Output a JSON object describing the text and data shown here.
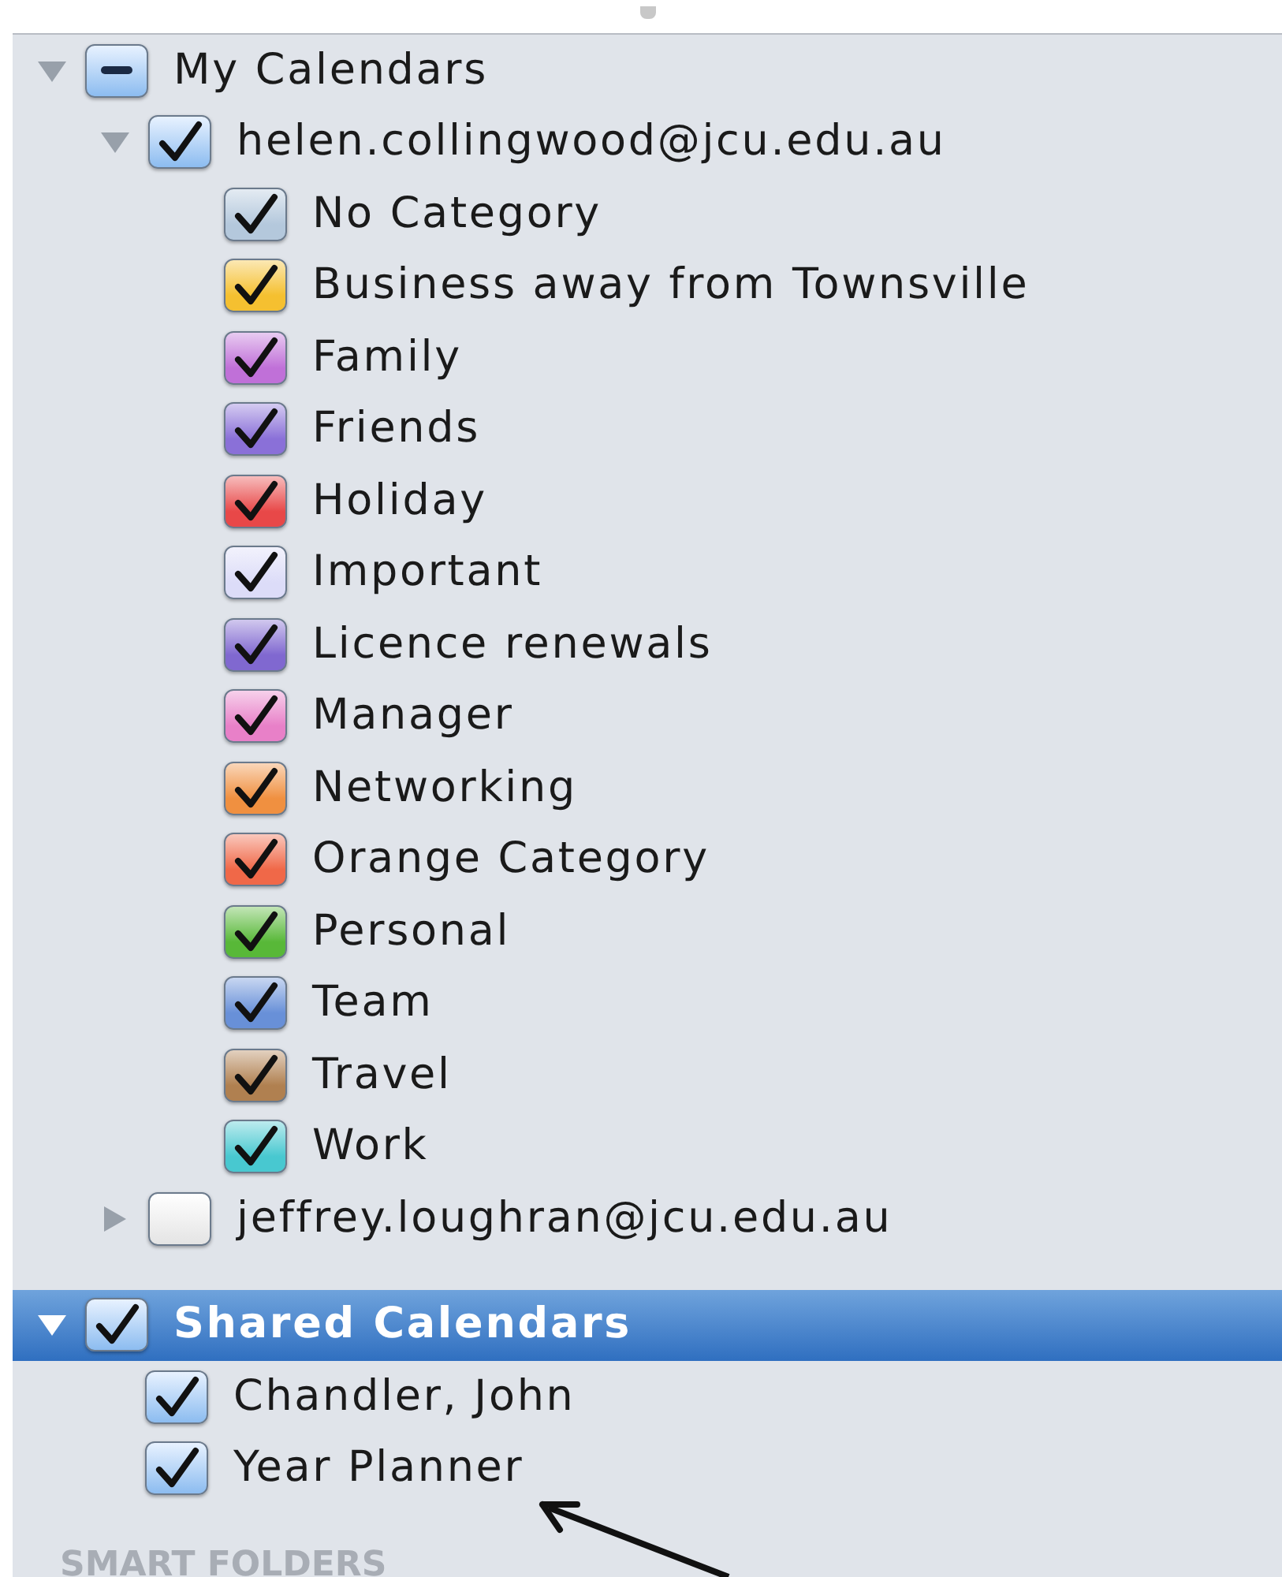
{
  "sections": [
    {
      "label": "My Calendars",
      "checked": true,
      "mixed": true,
      "expanded": true,
      "selected": false,
      "children": [
        {
          "label": "helen.collingwood@jcu.edu.au",
          "checked": true,
          "expanded": true,
          "selected": false,
          "children": [
            {
              "label": "No Category",
              "checked": true,
              "selected": false,
              "color": "#b4c8dc"
            },
            {
              "label": "Business away from Townsville",
              "checked": true,
              "selected": false,
              "color": "#f5c030"
            },
            {
              "label": "Family",
              "checked": true,
              "selected": false,
              "color": "#c070d8"
            },
            {
              "label": "Friends",
              "checked": true,
              "selected": false,
              "color": "#8a70d8"
            },
            {
              "label": "Holiday",
              "checked": true,
              "selected": false,
              "color": "#e84848"
            },
            {
              "label": "Important",
              "checked": true,
              "selected": false,
              "color": "#dcdcf8"
            },
            {
              "label": "Licence renewals",
              "checked": true,
              "selected": false,
              "color": "#8068d0"
            },
            {
              "label": "Manager",
              "checked": true,
              "selected": false,
              "color": "#e880c8"
            },
            {
              "label": "Networking",
              "checked": true,
              "selected": false,
              "color": "#f09040"
            },
            {
              "label": "Orange Category",
              "checked": true,
              "selected": false,
              "color": "#f06848"
            },
            {
              "label": "Personal",
              "checked": true,
              "selected": false,
              "color": "#58b838"
            },
            {
              "label": "Team",
              "checked": true,
              "selected": false,
              "color": "#6890d8"
            },
            {
              "label": "Travel",
              "checked": true,
              "selected": false,
              "color": "#b08050"
            },
            {
              "label": "Work",
              "checked": true,
              "selected": false,
              "color": "#48c8d0"
            }
          ]
        },
        {
          "label": "jeffrey.loughran@jcu.edu.au",
          "checked": false,
          "expanded": false,
          "selected": false
        }
      ]
    },
    {
      "label": "Shared Calendars",
      "checked": true,
      "expanded": true,
      "selected": true,
      "children": [
        {
          "label": "Chandler, John",
          "checked": true,
          "selected": false
        },
        {
          "label": "Year Planner",
          "checked": true,
          "selected": false
        }
      ]
    }
  ],
  "footer_heading": "SMART FOLDERS"
}
